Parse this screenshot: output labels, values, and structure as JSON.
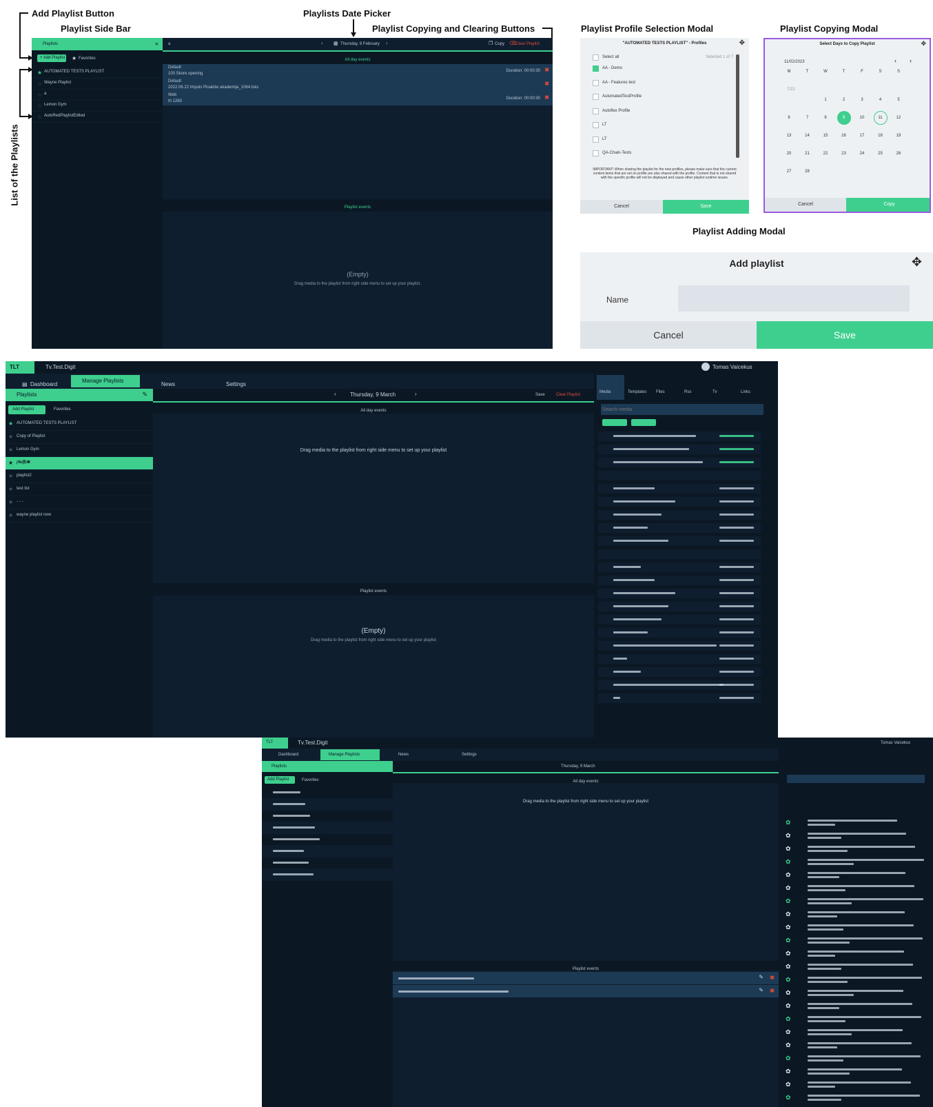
{
  "annotations": {
    "add_playlist_button": "Add Playlist Button",
    "playlist_side_bar": "Playlist Side Bar",
    "list_of_playlists": "List of the Playlists",
    "date_picker": "Playlists Date Picker",
    "copy_clear_buttons": "Playlist Copying  and Clearing Buttons",
    "profile_modal_title": "Playlist Profile Selection Modal",
    "copy_modal_title": "Playlist Copying Modal",
    "add_modal_title": "Playlist Adding Modal"
  },
  "app1": {
    "sidebar_title": "Playlists",
    "add_playlist": "+ Add Playlist",
    "favorites": "Favorites",
    "playlists": [
      "AUTOMATED TESTS PLAYLIST",
      "Wayne Playlist",
      "a",
      "Lemon Gym",
      "AutoRedPlaylistEdited"
    ],
    "date_label": "Thursday, 9 February",
    "copy": "Copy",
    "clear": "Clear Playlist",
    "all_day_events": "All day events",
    "events": [
      {
        "type": "Default",
        "name": "100 Skore opening",
        "duration": "Duration: 00:00:30"
      },
      {
        "type": "Default",
        "name": "2022.06.22 Impuls Ploaktiw akademija_1064.tsks",
        "duration": ""
      },
      {
        "type": "Web",
        "name": "th 1263",
        "duration": "Duration: 00:00:30"
      }
    ],
    "playlist_events": "Playlist events",
    "empty": "(Empty)",
    "empty_hint": "Drag media to the playlist from right side menu to set up your playlist."
  },
  "profile_modal": {
    "header": "\"AUTOMATED TESTS PLAYLIST\" - Profiles",
    "select_all": "Select all",
    "selected": "Selected 1 of 7",
    "items": [
      {
        "label": "AA - Demo",
        "checked": true
      },
      {
        "label": "AA - Features test",
        "checked": false
      },
      {
        "label": "AutomatedTestProfile",
        "checked": false
      },
      {
        "label": "Autoflex Profile",
        "checked": false
      },
      {
        "label": "LT",
        "checked": false
      },
      {
        "label": "LT",
        "checked": false
      },
      {
        "label": "QA-Chain-Tests",
        "checked": false
      }
    ],
    "note": "IMPORTANT! When sharing the playlist for the new profiles, please make sure that the current content items that are set on profile are also shared with the profile. Content that is not shared with the specific profile will not be displayed and cause other playlist runtime issues.",
    "cancel": "Cancel",
    "save": "Save"
  },
  "copy_modal": {
    "header": "Select Days to Copy Playlist",
    "month": "11/02/2023",
    "weekdays": [
      "M",
      "T",
      "W",
      "T",
      "F",
      "S",
      "S"
    ],
    "week_label": "7/22",
    "weeks": [
      [
        "",
        "",
        "1",
        "2",
        "3",
        "4",
        "5"
      ],
      [
        "6",
        "7",
        "8",
        "9",
        "10",
        "11",
        "12"
      ],
      [
        "13",
        "14",
        "15",
        "16",
        "17",
        "18",
        "19"
      ],
      [
        "20",
        "21",
        "22",
        "23",
        "24",
        "25",
        "26"
      ],
      [
        "27",
        "28",
        "",
        "",
        "",
        "",
        ""
      ]
    ],
    "selected_day": "9",
    "ring_day": "11",
    "cancel": "Cancel",
    "copy": "Copy"
  },
  "add_modal": {
    "title": "Add playlist",
    "name_label": "Name",
    "name_value": "",
    "cancel": "Cancel",
    "save": "Save"
  },
  "app2": {
    "logo": "TLT",
    "title": "Tv.Test.Digit",
    "tabs": [
      "Dashboard",
      "Manage Playlists",
      "News",
      "Settings"
    ],
    "sidebar_title": "Playlists",
    "add_playlist": "Add Playlist",
    "favorites": "Favorites",
    "playlists": [
      "AUTOMATED TESTS PLAYLIST",
      "Copy of Playlist",
      "Lemon Gym",
      "playlist",
      "playlist2",
      "test list",
      "- - -",
      "wayne playlist new"
    ],
    "date_label": "Thursday, 9 March",
    "save": "Save",
    "clear": "Clear Playlist",
    "all_day": "All day events",
    "drag_hint": "Drag media to the playlist from right side menu to set up your playlist",
    "playlist_events": "Playlist events",
    "empty": "(Empty)",
    "empty_hint": "Drag media to the playlist from right side menu to set up your playlist",
    "user": "Tomas Vaicekus",
    "right_tabs": [
      "Media",
      "Templates",
      "Files",
      "Rss",
      "Tv",
      "Links"
    ],
    "search_placeholder": "Search media"
  },
  "app3": {
    "logo": "TLT",
    "title": "Tv.Test.Digit",
    "tabs": [
      "Dashboard",
      "Manage Playlists",
      "News",
      "Settings"
    ],
    "sidebar_title": "Playlists",
    "add_playlist": "Add Playlist",
    "favorites": "Favorites",
    "date_label": "Thursday, 9 March",
    "all_day": "All day events",
    "drag_hint": "Drag media to the playlist from right side menu to set up your playlist",
    "playlist_events": "Playlist events",
    "user": "Tomas Vaicekus"
  }
}
